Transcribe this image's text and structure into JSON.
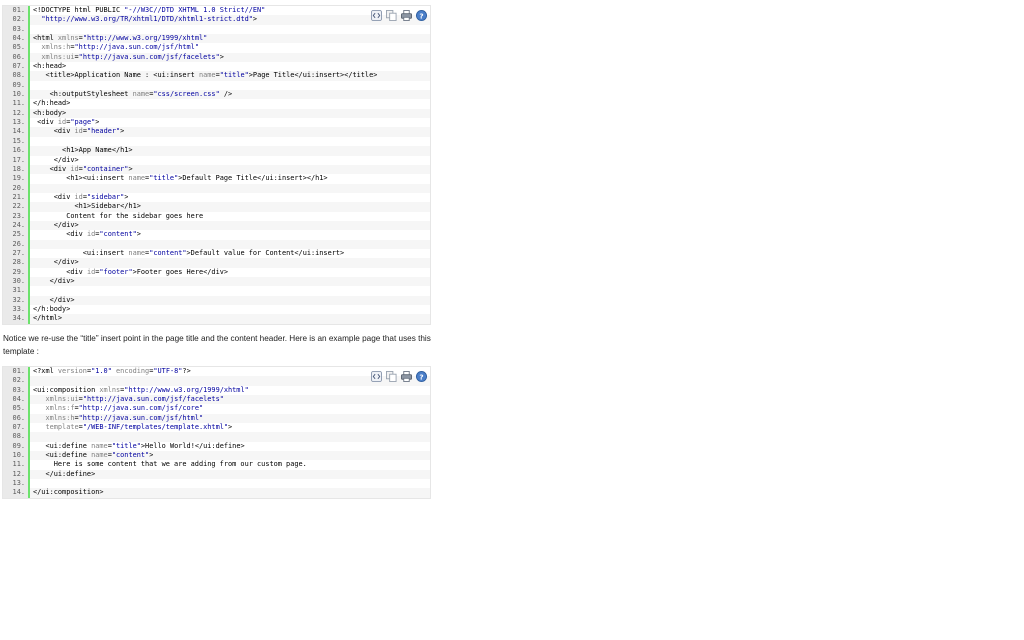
{
  "toolbar": {
    "icons": [
      "view-source-icon",
      "copy-icon",
      "print-icon",
      "help-icon"
    ]
  },
  "block1": {
    "lines": [
      {
        "n": "01.",
        "t": "<!DOCTYPE html PUBLIC \"-//W3C//DTD XHTML 1.0 Strict//EN\""
      },
      {
        "n": "02.",
        "t": "  \"http://www.w3.org/TR/xhtml1/DTD/xhtml1-strict.dtd\">"
      },
      {
        "n": "03.",
        "t": ""
      },
      {
        "n": "04.",
        "t": "<html xmlns=\"http://www.w3.org/1999/xhtml\""
      },
      {
        "n": "05.",
        "t": "  xmlns:h=\"http://java.sun.com/jsf/html\""
      },
      {
        "n": "06.",
        "t": "  xmlns:ui=\"http://java.sun.com/jsf/facelets\">"
      },
      {
        "n": "07.",
        "t": "<h:head>"
      },
      {
        "n": "08.",
        "t": "   <title>Application Name : <ui:insert name=\"title\">Page Title</ui:insert></title>"
      },
      {
        "n": "09.",
        "t": ""
      },
      {
        "n": "10.",
        "t": "    <h:outputStylesheet name=\"css/screen.css\" />"
      },
      {
        "n": "11.",
        "t": "</h:head>"
      },
      {
        "n": "12.",
        "t": "<h:body>"
      },
      {
        "n": "13.",
        "t": " <div id=\"page\">"
      },
      {
        "n": "14.",
        "t": "     <div id=\"header\">"
      },
      {
        "n": "15.",
        "t": ""
      },
      {
        "n": "16.",
        "t": "       <h1>App Name</h1>"
      },
      {
        "n": "17.",
        "t": "     </div>"
      },
      {
        "n": "18.",
        "t": "    <div id=\"container\">"
      },
      {
        "n": "19.",
        "t": "        <h1><ui:insert name=\"title\">Default Page Title</ui:insert></h1>"
      },
      {
        "n": "20.",
        "t": ""
      },
      {
        "n": "21.",
        "t": "     <div id=\"sidebar\">"
      },
      {
        "n": "22.",
        "t": "          <h1>Sidebar</h1>"
      },
      {
        "n": "23.",
        "t": "        Content for the sidebar goes here"
      },
      {
        "n": "24.",
        "t": "     </div>"
      },
      {
        "n": "25.",
        "t": "        <div id=\"content\">"
      },
      {
        "n": "26.",
        "t": ""
      },
      {
        "n": "27.",
        "t": "            <ui:insert name=\"content\">Default value for Content</ui:insert>"
      },
      {
        "n": "28.",
        "t": "     </div>"
      },
      {
        "n": "29.",
        "t": "        <div id=\"footer\">Footer goes Here</div>"
      },
      {
        "n": "30.",
        "t": "    </div>"
      },
      {
        "n": "31.",
        "t": ""
      },
      {
        "n": "32.",
        "t": "    </div>"
      },
      {
        "n": "33.",
        "t": "</h:body>"
      },
      {
        "n": "34.",
        "t": "</html>"
      }
    ]
  },
  "prose": {
    "text": "Notice we re-use the “title” insert point in the page title and the content header. Here is an example page that uses this template :"
  },
  "block2": {
    "lines": [
      {
        "n": "01.",
        "t": "<?xml version=\"1.0\" encoding=\"UTF-8\"?>"
      },
      {
        "n": "02.",
        "t": ""
      },
      {
        "n": "03.",
        "t": "<ui:composition xmlns=\"http://www.w3.org/1999/xhtml\""
      },
      {
        "n": "04.",
        "t": "   xmlns:ui=\"http://java.sun.com/jsf/facelets\""
      },
      {
        "n": "05.",
        "t": "   xmlns:f=\"http://java.sun.com/jsf/core\""
      },
      {
        "n": "06.",
        "t": "   xmlns:h=\"http://java.sun.com/jsf/html\""
      },
      {
        "n": "07.",
        "t": "   template=\"/WEB-INF/templates/template.xhtml\">"
      },
      {
        "n": "08.",
        "t": ""
      },
      {
        "n": "09.",
        "t": "   <ui:define name=\"title\">Hello World!</ui:define>"
      },
      {
        "n": "10.",
        "t": "   <ui:define name=\"content\">"
      },
      {
        "n": "11.",
        "t": "     Here is some content that we are adding from our custom page."
      },
      {
        "n": "12.",
        "t": "   </ui:define>"
      },
      {
        "n": "13.",
        "t": ""
      },
      {
        "n": "14.",
        "t": "</ui:composition>"
      }
    ]
  }
}
